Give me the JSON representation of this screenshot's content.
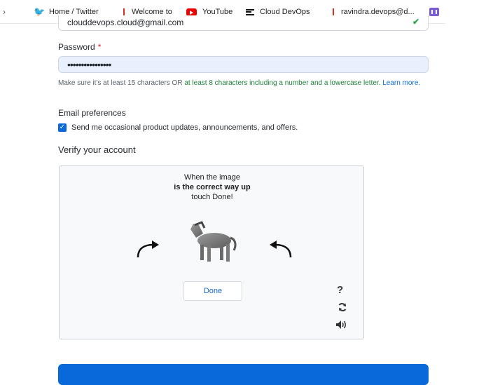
{
  "bookmarks": {
    "items": [
      {
        "label": "Home / Twitter",
        "icon": "twitter-icon"
      },
      {
        "label": "Welcome to",
        "icon": "bookmark-marker-icon"
      },
      {
        "label": "YouTube",
        "icon": "youtube-icon"
      },
      {
        "label": "Cloud DevOps",
        "icon": "cloud-devops-icon"
      },
      {
        "label": "ravindra.devops@d...",
        "icon": "bookmark-marker-icon"
      },
      {
        "label": "",
        "icon": "app-icon"
      }
    ]
  },
  "form": {
    "email_value": "clouddevops.cloud@gmail.com",
    "password_label": "Password",
    "required_mark": "*",
    "password_value": "••••••••••••••••",
    "hint_prefix": "Make sure it's at least 15 characters OR ",
    "hint_green": "at least 8 characters including a number and a lowercase letter.",
    "learn_more": "Learn more.",
    "email_pref_label": "Email preferences",
    "email_pref_checkbox_label": "Send me occasional product updates, announcements, and offers.",
    "email_pref_checked": true,
    "verify_heading": "Verify your account"
  },
  "captcha": {
    "line1": "When the image",
    "line2": "is the correct way up",
    "line3": "touch Done!",
    "done_label": "Done",
    "help_symbol": "?"
  },
  "colors": {
    "accent": "#0969da",
    "success": "#1a7f37",
    "required": "#cf222e",
    "password_bg": "#e8f0fe"
  }
}
